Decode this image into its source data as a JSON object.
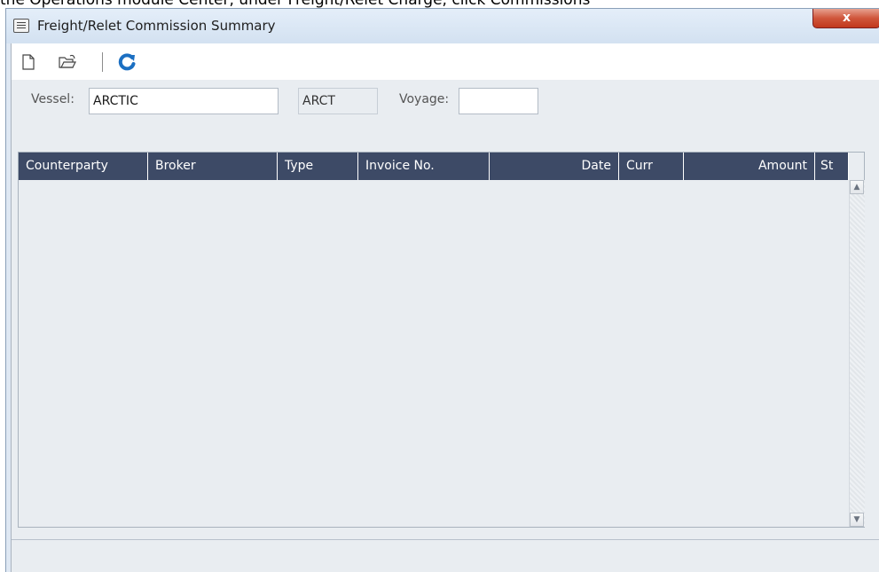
{
  "background_text": "the Operations module Center, under Freight/Relet Charge, click Commissions",
  "window": {
    "title": "Freight/Relet Commission Summary",
    "close_label": "x"
  },
  "toolbar": {
    "icons": [
      "new-document-icon",
      "open-folder-icon",
      "refresh-icon"
    ]
  },
  "filter": {
    "vessel_label": "Vessel:",
    "vessel_value": "ARCTIC",
    "vessel_code": "ARCT",
    "voyage_label": "Voyage:",
    "voyage_value": ""
  },
  "grid": {
    "columns": [
      {
        "label": "Counterparty",
        "align": "left"
      },
      {
        "label": "Broker",
        "align": "left"
      },
      {
        "label": "Type",
        "align": "left"
      },
      {
        "label": "Invoice No.",
        "align": "left"
      },
      {
        "label": "Date",
        "align": "right"
      },
      {
        "label": "Curr",
        "align": "left"
      },
      {
        "label": "Amount",
        "align": "right"
      },
      {
        "label": "St",
        "align": "left"
      }
    ],
    "rows": []
  },
  "colors": {
    "header_bg": "#3d4a66",
    "refresh_blue": "#1b6fc2"
  }
}
